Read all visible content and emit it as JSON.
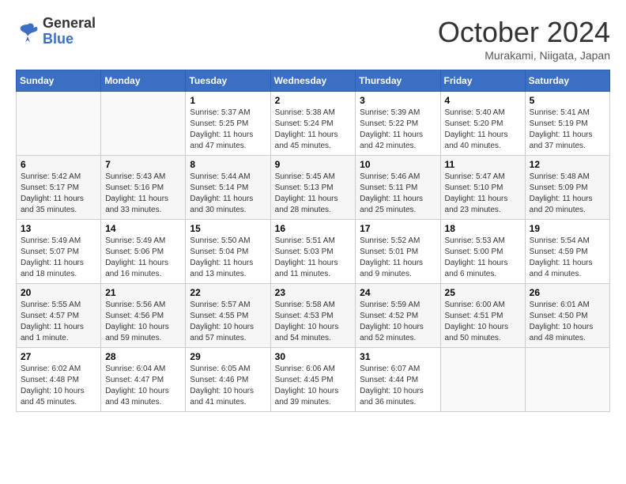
{
  "header": {
    "logo_line1": "General",
    "logo_line2": "Blue",
    "month": "October 2024",
    "location": "Murakami, Niigata, Japan"
  },
  "weekdays": [
    "Sunday",
    "Monday",
    "Tuesday",
    "Wednesday",
    "Thursday",
    "Friday",
    "Saturday"
  ],
  "weeks": [
    [
      {
        "day": "",
        "info": ""
      },
      {
        "day": "",
        "info": ""
      },
      {
        "day": "1",
        "info": "Sunrise: 5:37 AM\nSunset: 5:25 PM\nDaylight: 11 hours and 47 minutes."
      },
      {
        "day": "2",
        "info": "Sunrise: 5:38 AM\nSunset: 5:24 PM\nDaylight: 11 hours and 45 minutes."
      },
      {
        "day": "3",
        "info": "Sunrise: 5:39 AM\nSunset: 5:22 PM\nDaylight: 11 hours and 42 minutes."
      },
      {
        "day": "4",
        "info": "Sunrise: 5:40 AM\nSunset: 5:20 PM\nDaylight: 11 hours and 40 minutes."
      },
      {
        "day": "5",
        "info": "Sunrise: 5:41 AM\nSunset: 5:19 PM\nDaylight: 11 hours and 37 minutes."
      }
    ],
    [
      {
        "day": "6",
        "info": "Sunrise: 5:42 AM\nSunset: 5:17 PM\nDaylight: 11 hours and 35 minutes."
      },
      {
        "day": "7",
        "info": "Sunrise: 5:43 AM\nSunset: 5:16 PM\nDaylight: 11 hours and 33 minutes."
      },
      {
        "day": "8",
        "info": "Sunrise: 5:44 AM\nSunset: 5:14 PM\nDaylight: 11 hours and 30 minutes."
      },
      {
        "day": "9",
        "info": "Sunrise: 5:45 AM\nSunset: 5:13 PM\nDaylight: 11 hours and 28 minutes."
      },
      {
        "day": "10",
        "info": "Sunrise: 5:46 AM\nSunset: 5:11 PM\nDaylight: 11 hours and 25 minutes."
      },
      {
        "day": "11",
        "info": "Sunrise: 5:47 AM\nSunset: 5:10 PM\nDaylight: 11 hours and 23 minutes."
      },
      {
        "day": "12",
        "info": "Sunrise: 5:48 AM\nSunset: 5:09 PM\nDaylight: 11 hours and 20 minutes."
      }
    ],
    [
      {
        "day": "13",
        "info": "Sunrise: 5:49 AM\nSunset: 5:07 PM\nDaylight: 11 hours and 18 minutes."
      },
      {
        "day": "14",
        "info": "Sunrise: 5:49 AM\nSunset: 5:06 PM\nDaylight: 11 hours and 16 minutes."
      },
      {
        "day": "15",
        "info": "Sunrise: 5:50 AM\nSunset: 5:04 PM\nDaylight: 11 hours and 13 minutes."
      },
      {
        "day": "16",
        "info": "Sunrise: 5:51 AM\nSunset: 5:03 PM\nDaylight: 11 hours and 11 minutes."
      },
      {
        "day": "17",
        "info": "Sunrise: 5:52 AM\nSunset: 5:01 PM\nDaylight: 11 hours and 9 minutes."
      },
      {
        "day": "18",
        "info": "Sunrise: 5:53 AM\nSunset: 5:00 PM\nDaylight: 11 hours and 6 minutes."
      },
      {
        "day": "19",
        "info": "Sunrise: 5:54 AM\nSunset: 4:59 PM\nDaylight: 11 hours and 4 minutes."
      }
    ],
    [
      {
        "day": "20",
        "info": "Sunrise: 5:55 AM\nSunset: 4:57 PM\nDaylight: 11 hours and 1 minute."
      },
      {
        "day": "21",
        "info": "Sunrise: 5:56 AM\nSunset: 4:56 PM\nDaylight: 10 hours and 59 minutes."
      },
      {
        "day": "22",
        "info": "Sunrise: 5:57 AM\nSunset: 4:55 PM\nDaylight: 10 hours and 57 minutes."
      },
      {
        "day": "23",
        "info": "Sunrise: 5:58 AM\nSunset: 4:53 PM\nDaylight: 10 hours and 54 minutes."
      },
      {
        "day": "24",
        "info": "Sunrise: 5:59 AM\nSunset: 4:52 PM\nDaylight: 10 hours and 52 minutes."
      },
      {
        "day": "25",
        "info": "Sunrise: 6:00 AM\nSunset: 4:51 PM\nDaylight: 10 hours and 50 minutes."
      },
      {
        "day": "26",
        "info": "Sunrise: 6:01 AM\nSunset: 4:50 PM\nDaylight: 10 hours and 48 minutes."
      }
    ],
    [
      {
        "day": "27",
        "info": "Sunrise: 6:02 AM\nSunset: 4:48 PM\nDaylight: 10 hours and 45 minutes."
      },
      {
        "day": "28",
        "info": "Sunrise: 6:04 AM\nSunset: 4:47 PM\nDaylight: 10 hours and 43 minutes."
      },
      {
        "day": "29",
        "info": "Sunrise: 6:05 AM\nSunset: 4:46 PM\nDaylight: 10 hours and 41 minutes."
      },
      {
        "day": "30",
        "info": "Sunrise: 6:06 AM\nSunset: 4:45 PM\nDaylight: 10 hours and 39 minutes."
      },
      {
        "day": "31",
        "info": "Sunrise: 6:07 AM\nSunset: 4:44 PM\nDaylight: 10 hours and 36 minutes."
      },
      {
        "day": "",
        "info": ""
      },
      {
        "day": "",
        "info": ""
      }
    ]
  ]
}
